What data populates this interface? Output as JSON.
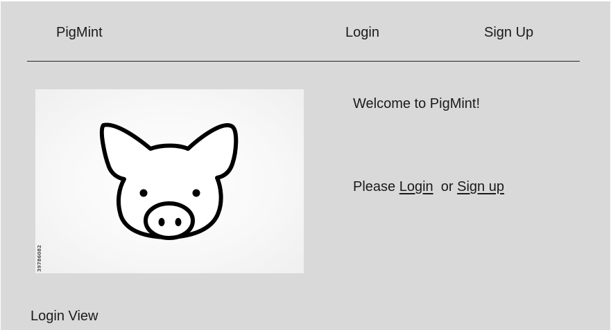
{
  "header": {
    "brand": "PigMint",
    "login_label": "Login",
    "signup_label": "Sign Up"
  },
  "hero": {
    "icon": "pig-face-icon",
    "stock_id": "39786082"
  },
  "main": {
    "welcome": "Welcome to PigMint!",
    "prompt_prefix": "Please ",
    "login_link": "Login",
    "prompt_middle": "  or ",
    "signup_link": "Sign up"
  },
  "caption": "Login View",
  "colors": {
    "background": "#d9d9d9",
    "text": "#1a1a1a",
    "divider": "#222222"
  }
}
